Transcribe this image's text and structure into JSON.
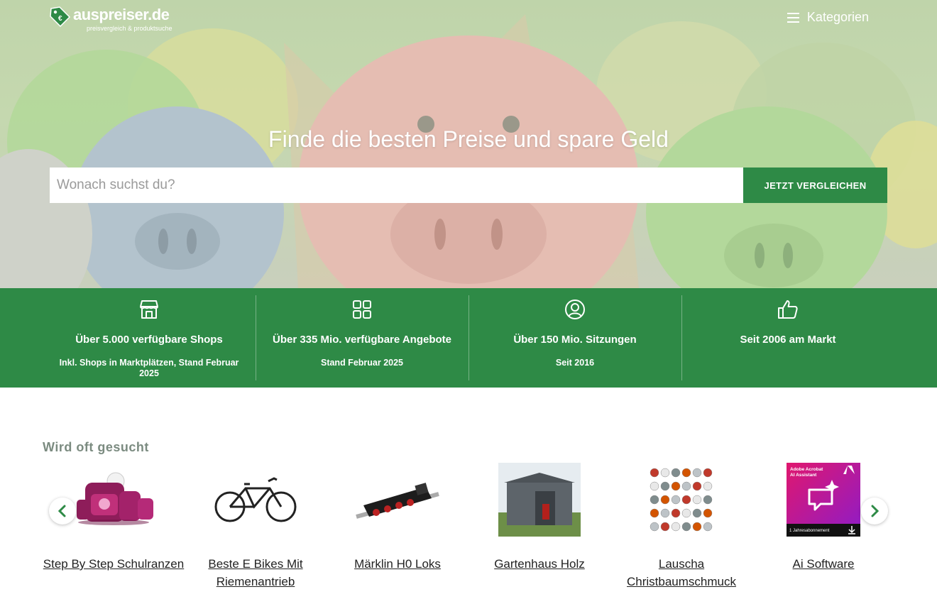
{
  "brand": {
    "name": "auspreiser",
    "tld": ".de",
    "tagline": "preisvergleich & produktsuche"
  },
  "nav": {
    "categories_label": "Kategorien"
  },
  "hero": {
    "title": "Finde die besten Preise und spare Geld",
    "search_placeholder": "Wonach suchst du?",
    "search_button": "JETZT VERGLEICHEN"
  },
  "stats": [
    {
      "icon": "store-icon",
      "title": "Über 5.000 verfügbare Shops",
      "subtitle": "Inkl. Shops in Marktplätzen, Stand Februar 2025"
    },
    {
      "icon": "grid-icon",
      "title": "Über 335 Mio. verfügbare Angebote",
      "subtitle": "Stand Februar 2025"
    },
    {
      "icon": "user-circle-icon",
      "title": "Über 150 Mio. Sitzungen",
      "subtitle": "Seit 2016"
    },
    {
      "icon": "thumbs-up-icon",
      "title": "Seit 2006 am Markt",
      "subtitle": ""
    }
  ],
  "popular": {
    "title": "Wird oft gesucht",
    "items": [
      {
        "label": "Step By Step Schulranzen"
      },
      {
        "label": "Beste E Bikes Mit Riemenantrieb"
      },
      {
        "label": "Märklin H0 Loks"
      },
      {
        "label": "Gartenhaus Holz"
      },
      {
        "label": "Lauscha Christbaumschmuck"
      },
      {
        "label": "Ai Software"
      }
    ],
    "software_box_text": {
      "title": "Adobe Acrobat AI Assistant",
      "footer": "1 Jahresabonnement"
    }
  },
  "colors": {
    "brand_green": "#2e8a46",
    "section_title": "#7b8b80"
  }
}
